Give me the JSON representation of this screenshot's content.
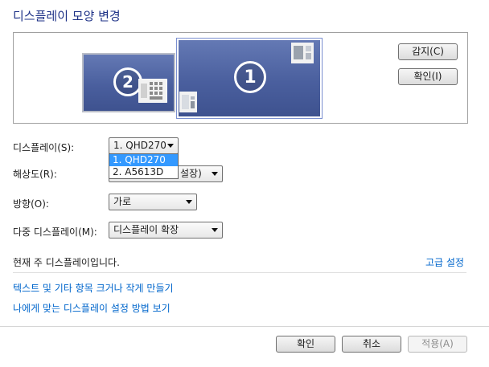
{
  "title": "디스플레이 모양 변경",
  "preview": {
    "monitor1_number": "1",
    "monitor2_number": "2"
  },
  "buttons": {
    "detect": "감지(C)",
    "identify": "확인(I)"
  },
  "form": {
    "display_label": "디스플레이(S):",
    "display_value": "1. QHD270",
    "display_options": [
      "1. QHD270",
      "2. A5613D"
    ],
    "resolution_label": "해상도(R):",
    "resolution_partial_visible": "설장)",
    "orientation_label": "방향(O):",
    "orientation_value": "가로",
    "multi_display_label": "다중 디스플레이(M):",
    "multi_display_value": "디스플레이 확장"
  },
  "status_text": "현재 주 디스플레이입니다.",
  "links": {
    "advanced": "고급 설정",
    "text_size": "텍스트 및 기타 항목 크거나 작게 만들기",
    "which_settings": "나에게 맞는 디스플레이 설정 방법 보기"
  },
  "footer": {
    "ok": "확인",
    "cancel": "취소",
    "apply": "적용(A)"
  },
  "colors": {
    "title": "#1e3287",
    "link": "#0066cc",
    "selection": "#3399ff",
    "monitor_fill": "#4a5f9e"
  }
}
